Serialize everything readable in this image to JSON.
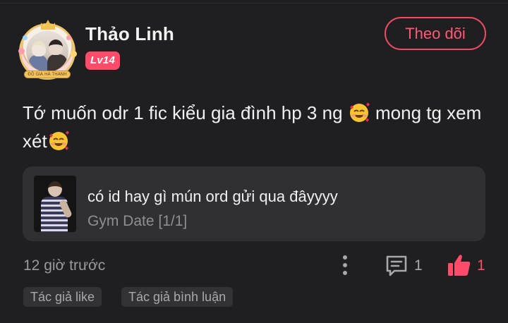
{
  "author": {
    "name": "Thảo Linh",
    "level": "Lv14",
    "avatar_ribbon_text": "ĐỖ GIA HÀ THANH"
  },
  "follow_button": {
    "label": "Theo dõi"
  },
  "comment": {
    "text_part1": "Tớ muốn odr 1 fic kiểu gia đình hp 3 ng",
    "text_part2": " mong tg xem xét",
    "emoji_icon": "smiling-face-with-hearts"
  },
  "quoted_story": {
    "title": "có id hay gì mún ord gửi qua đâyyyy",
    "subtitle": "Gym Date [1/1]"
  },
  "meta": {
    "timestamp": "12 giờ trước",
    "comment_count": "1",
    "like_count": "1"
  },
  "tags": [
    "Tác giả like",
    "Tác giả bình luận"
  ],
  "colors": {
    "accent": "#ff4b6a",
    "background": "#1f1f21",
    "card": "#303033"
  }
}
